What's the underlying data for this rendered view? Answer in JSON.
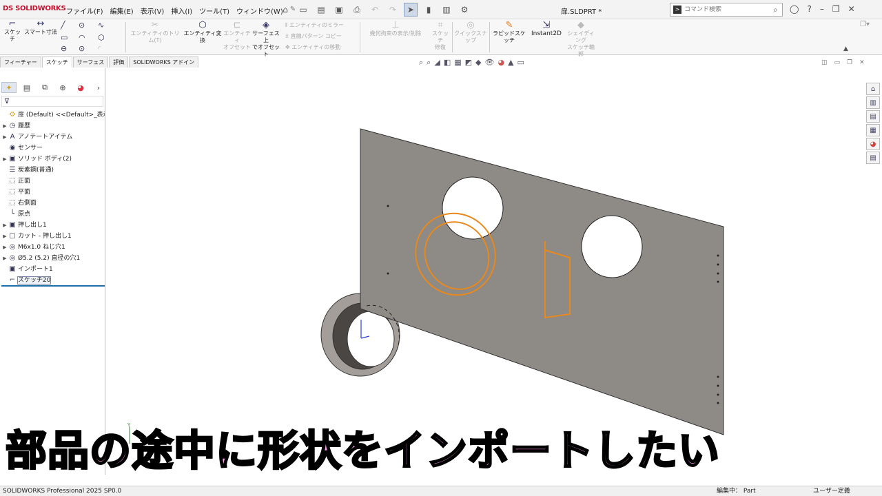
{
  "app": {
    "logo": "DS SOLIDWORKS",
    "doc_title": "扉.SLDPRT *",
    "search_placeholder": "コマンド検索"
  },
  "menu": [
    "ファイル(F)",
    "編集(E)",
    "表示(V)",
    "挿入(I)",
    "ツール(T)",
    "ウィンドウ(W)"
  ],
  "ribbon": {
    "sketch": "スケッチ",
    "smart_dim": "スマート寸法",
    "trim": "エンティティのトリム(T)",
    "convert": "エンティティ変換",
    "offset_l1": "エンティティ",
    "offset_l2": "オフセット",
    "surf_offset_l1": "サーフェス上",
    "surf_offset_l2": "でオフセット",
    "mirror": "エンティティのミラー",
    "linear_pattern": "直線パターン コピー",
    "move": "エンティティの移動",
    "relations": "幾何拘束の表示/削除",
    "repair_l1": "スケッチ",
    "repair_l2": "修復",
    "quick_snap": "クイックスナップ",
    "rapid_sketch": "ラピッドスケッチ",
    "instant2d": "Instant2D",
    "shaded_l1": "シェイディング",
    "shaded_l2": "スケッチ輪郭"
  },
  "tabs": [
    {
      "label": "フィーチャー",
      "active": false
    },
    {
      "label": "スケッチ",
      "active": true
    },
    {
      "label": "サーフェス",
      "active": false
    },
    {
      "label": "評価",
      "active": false
    },
    {
      "label": "SOLIDWORKS アドイン",
      "active": false
    }
  ],
  "tree": [
    {
      "label": "扉 (Default) <<Default>_表示状",
      "arrow": "",
      "icon": "part-icon"
    },
    {
      "label": "履歴",
      "arrow": "▶",
      "icon": "history-icon"
    },
    {
      "label": "アノテートアイテム",
      "arrow": "▶",
      "icon": "annotation-icon"
    },
    {
      "label": "センサー",
      "arrow": "",
      "icon": "sensor-icon"
    },
    {
      "label": "ソリッド ボディ(2)",
      "arrow": "▶",
      "icon": "solid-body-icon"
    },
    {
      "label": "炭素鋼(普通)",
      "arrow": "",
      "icon": "material-icon"
    },
    {
      "label": "正面",
      "arrow": "",
      "icon": "plane-icon"
    },
    {
      "label": "平面",
      "arrow": "",
      "icon": "plane-icon"
    },
    {
      "label": "右側面",
      "arrow": "",
      "icon": "plane-icon"
    },
    {
      "label": "原点",
      "arrow": "",
      "icon": "origin-icon"
    },
    {
      "label": "押し出し1",
      "arrow": "▶",
      "icon": "extrude-icon"
    },
    {
      "label": "カット - 押し出し1",
      "arrow": "▶",
      "icon": "cut-extrude-icon"
    },
    {
      "label": "M6x1.0 ねじ穴1",
      "arrow": "▶",
      "icon": "hole-icon"
    },
    {
      "label": "Ø5.2 (5.2) 直径の穴1",
      "arrow": "▶",
      "icon": "hole-icon"
    },
    {
      "label": "インポート1",
      "arrow": "",
      "icon": "import-icon"
    },
    {
      "label": "スケッチ20",
      "arrow": "",
      "icon": "sketch-icon",
      "selected": true
    }
  ],
  "caption": "部品の途中に形状をインポートしたい",
  "status": {
    "left": "SOLIDWORKS Professional 2025 SP0.0",
    "mode": "編集中： Part",
    "units": "ユーザー定義"
  },
  "colors": {
    "sketch": "#e8891e",
    "plate": "#8e8a86",
    "caption_fill": "#ff9cf0",
    "brand": "#c8102e"
  }
}
